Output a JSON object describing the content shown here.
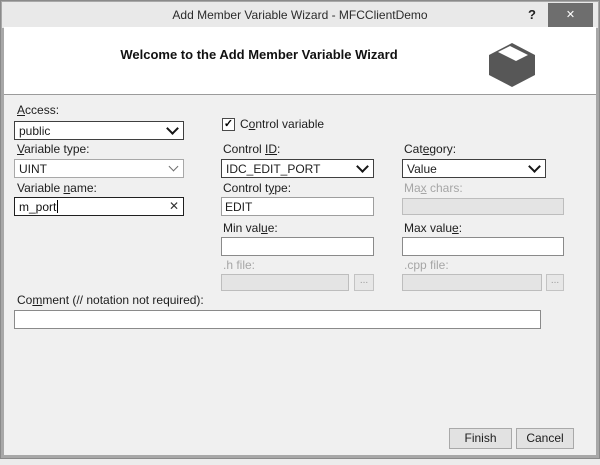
{
  "window": {
    "title": "Add Member Variable Wizard - MFCClientDemo",
    "help_glyph": "?",
    "close_glyph": "✕"
  },
  "header": {
    "title": "Welcome to the Add Member Variable Wizard",
    "icon": "wizard-box-icon"
  },
  "fields": {
    "access": {
      "label": "&Access:",
      "value": "public",
      "type": "combobox"
    },
    "control_variable": {
      "label": "C&ontrol variable",
      "checked": true,
      "glyph": "✓"
    },
    "variable_type": {
      "label": "&Variable type:",
      "value": "UINT",
      "type": "combobox"
    },
    "control_id": {
      "label": "Control &I&D:",
      "value": "IDC_EDIT_PORT",
      "type": "combobox"
    },
    "category": {
      "label": "Cat&egory:",
      "value": "Value",
      "type": "combobox"
    },
    "variable_name": {
      "label": "Variable &name:",
      "value": "m_port",
      "clear_glyph": "✕",
      "focused": true
    },
    "control_type": {
      "label": "Control t&ype:",
      "value": "EDIT"
    },
    "max_chars": {
      "label": "Ma&x chars:",
      "value": "",
      "disabled": true
    },
    "min_value": {
      "label": "Min val&ue:",
      "value": ""
    },
    "max_value": {
      "label": "Max valu&e:",
      "value": ""
    },
    "h_file": {
      "label": ".h file:",
      "value": "",
      "disabled": true,
      "browse_label": "..."
    },
    "cpp_file": {
      "label": ".cpp file:",
      "value": "",
      "disabled": true,
      "browse_label": "..."
    },
    "comment": {
      "label": "Co&mment (// notation not required):",
      "value": ""
    }
  },
  "buttons": {
    "finish_label": "Finish",
    "cancel_label": "Cancel"
  },
  "colors": {
    "titlebar_bg": "#e9e9e9",
    "dialog_bg": "#f0f0f0",
    "header_bg": "#ffffff",
    "frame": "#a8a8a8",
    "close_button_bg": "#6e6e6e",
    "focus_border": "#1f1f1f",
    "disabled_field_bg": "#e4e4e4",
    "button_bg": "#e2e2e2",
    "icon_color": "#575757"
  }
}
